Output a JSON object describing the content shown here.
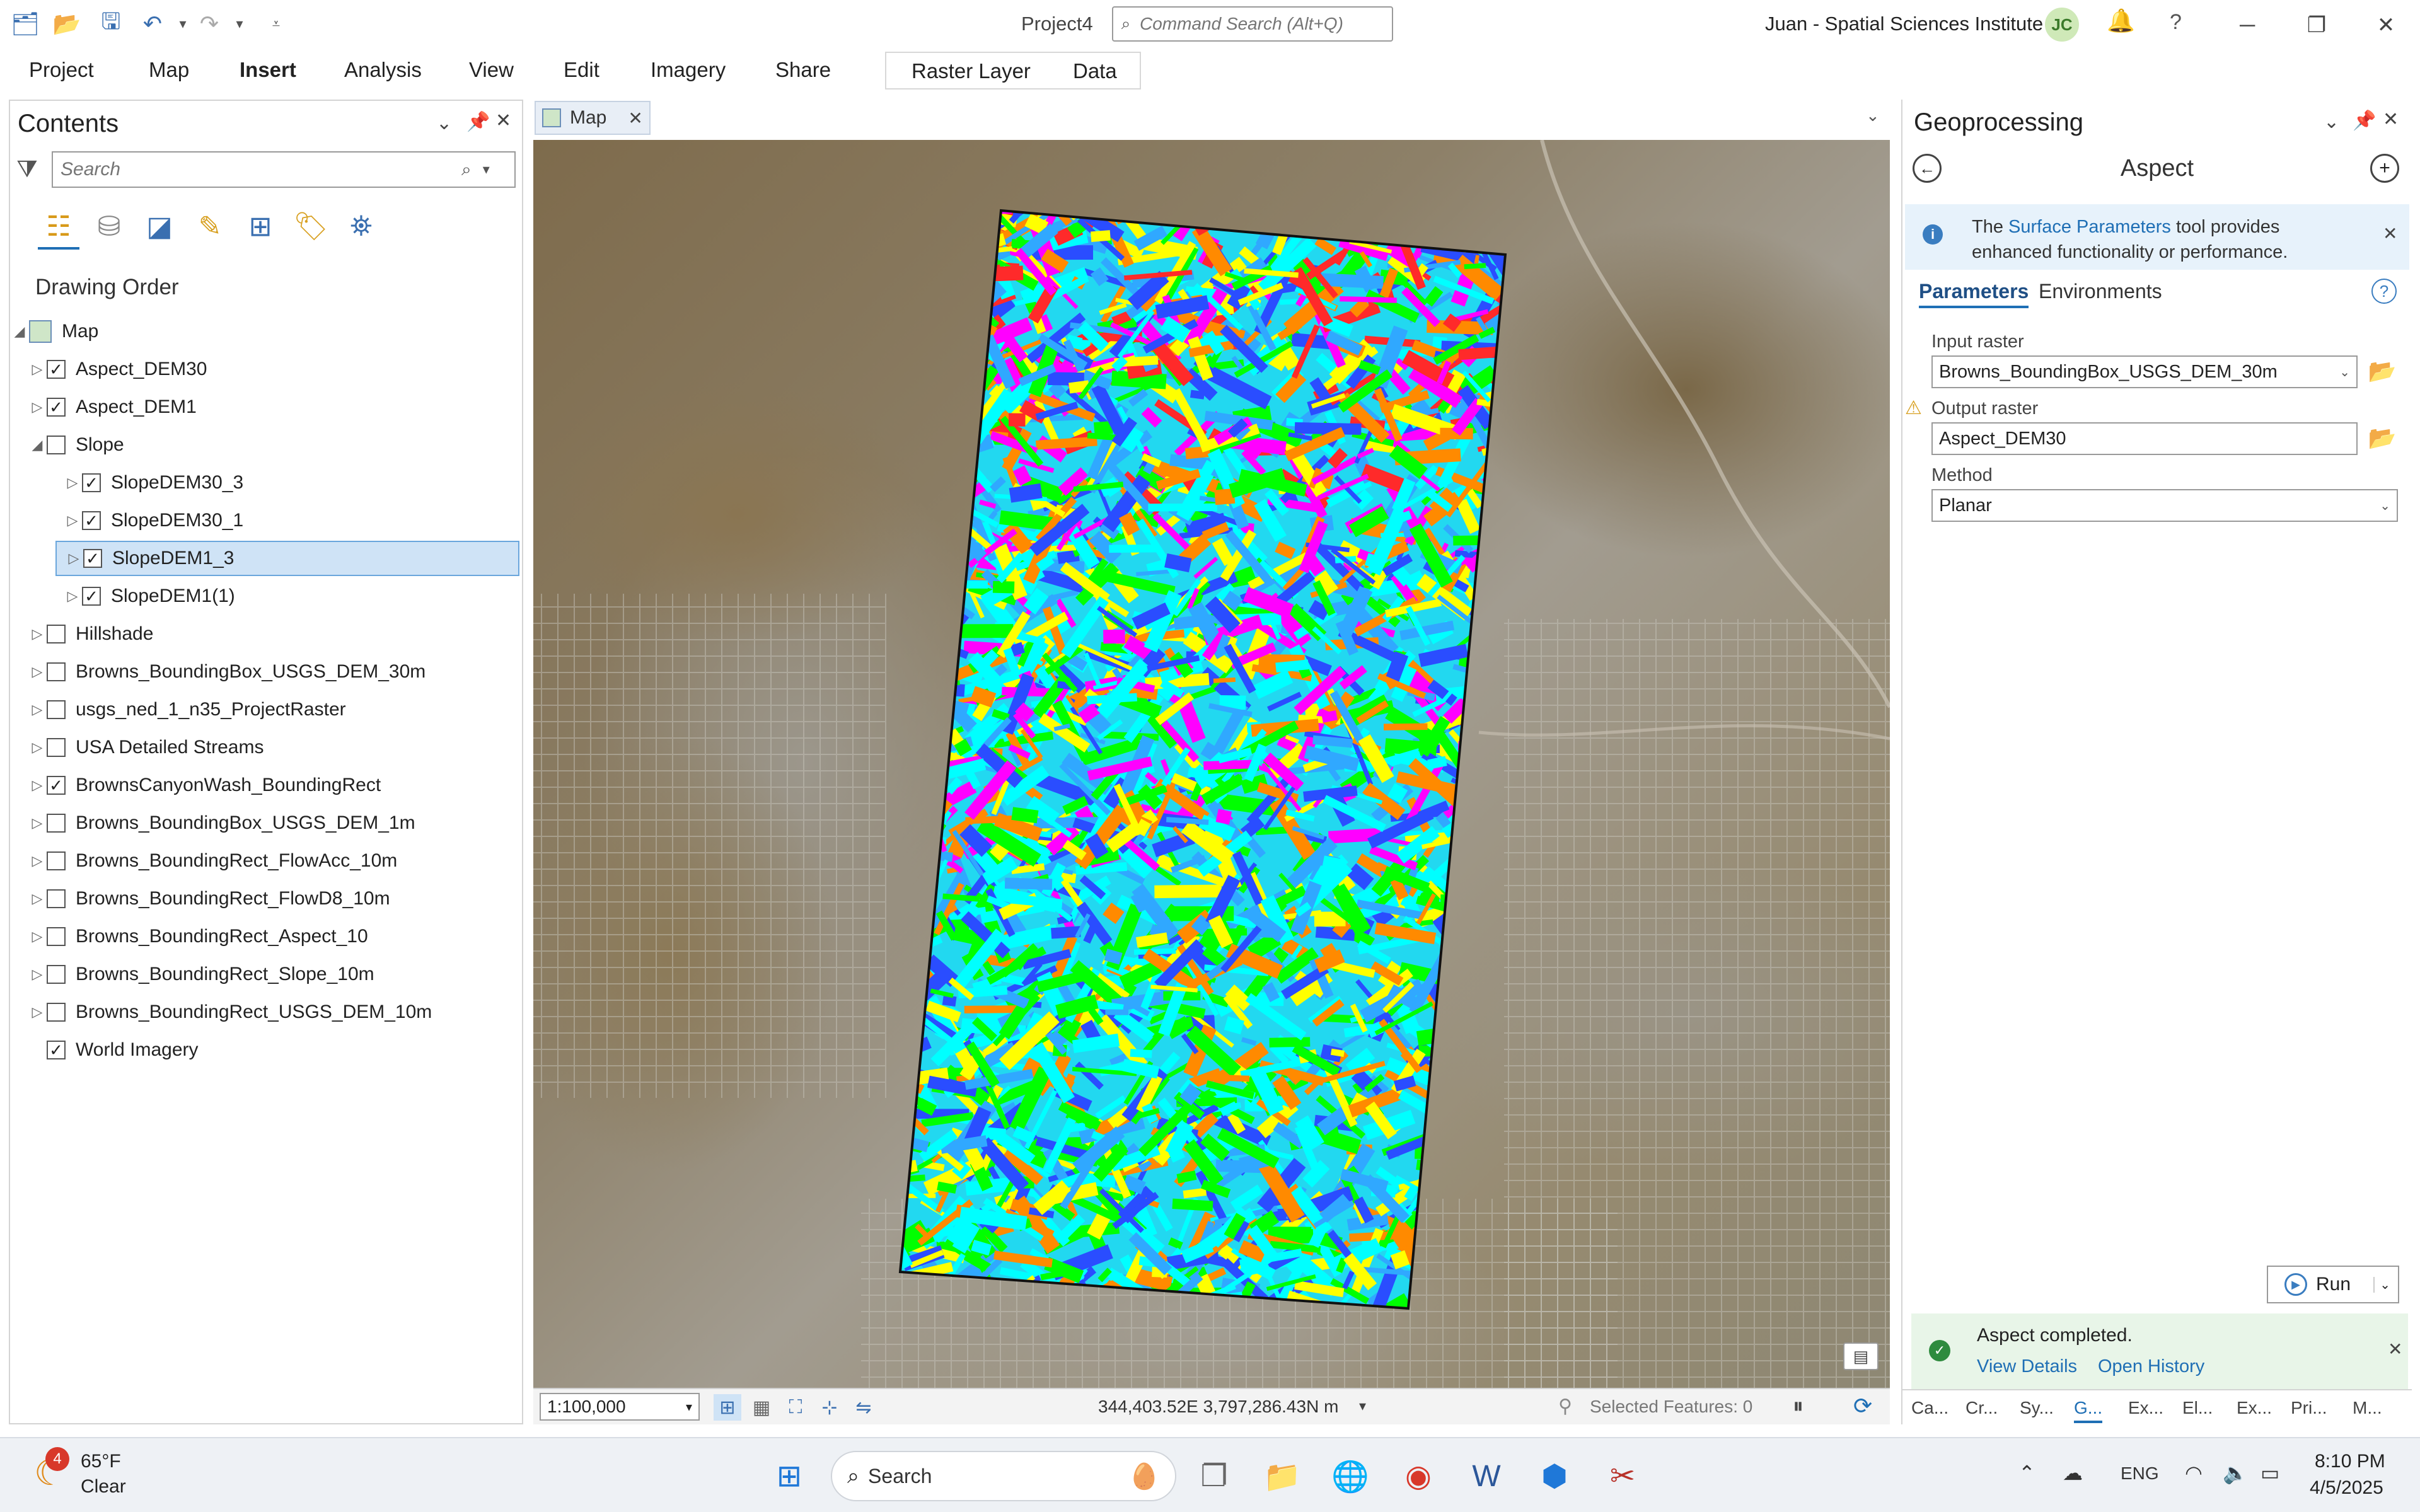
{
  "titlebar": {
    "project_title": "Project4",
    "command_search_placeholder": "Command Search (Alt+Q)",
    "user": "Juan - Spatial Sciences Institute",
    "avatar_initials": "JC",
    "help_symbol": "?"
  },
  "ribbon": {
    "tabs": [
      "Project",
      "Map",
      "Insert",
      "Analysis",
      "View",
      "Edit",
      "Imagery",
      "Share"
    ],
    "active_tab": "Insert",
    "contextual_tabs": [
      "Raster Layer",
      "Data"
    ]
  },
  "contents": {
    "title": "Contents",
    "search_placeholder": "Search",
    "section_title": "Drawing Order",
    "map_label": "Map",
    "layers": [
      {
        "name": "Aspect_DEM30",
        "checked": true,
        "indent": 0,
        "expander": "▷"
      },
      {
        "name": "Aspect_DEM1",
        "checked": true,
        "indent": 0,
        "expander": "▷"
      },
      {
        "name": "Slope",
        "checked": false,
        "indent": 0,
        "expander": "◢"
      },
      {
        "name": "SlopeDEM30_3",
        "checked": true,
        "indent": 1,
        "expander": "▷"
      },
      {
        "name": "SlopeDEM30_1",
        "checked": true,
        "indent": 1,
        "expander": "▷"
      },
      {
        "name": "SlopeDEM1_3",
        "checked": true,
        "indent": 1,
        "expander": "▷",
        "selected": true
      },
      {
        "name": "SlopeDEM1(1)",
        "checked": true,
        "indent": 1,
        "expander": "▷"
      },
      {
        "name": "Hillshade",
        "checked": false,
        "indent": 0,
        "expander": "▷"
      },
      {
        "name": "Browns_BoundingBox_USGS_DEM_30m",
        "checked": false,
        "indent": 0,
        "expander": "▷"
      },
      {
        "name": "usgs_ned_1_n35_ProjectRaster",
        "checked": false,
        "indent": 0,
        "expander": "▷"
      },
      {
        "name": "USA Detailed Streams",
        "checked": false,
        "indent": 0,
        "expander": "▷"
      },
      {
        "name": "BrownsCanyonWash_BoundingRect",
        "checked": true,
        "indent": 0,
        "expander": "▷"
      },
      {
        "name": "Browns_BoundingBox_USGS_DEM_1m",
        "checked": false,
        "indent": 0,
        "expander": "▷"
      },
      {
        "name": "Browns_BoundingRect_FlowAcc_10m",
        "checked": false,
        "indent": 0,
        "expander": "▷"
      },
      {
        "name": "Browns_BoundingRect_FlowD8_10m",
        "checked": false,
        "indent": 0,
        "expander": "▷"
      },
      {
        "name": "Browns_BoundingRect_Aspect_10",
        "checked": false,
        "indent": 0,
        "expander": "▷"
      },
      {
        "name": "Browns_BoundingRect_Slope_10m",
        "checked": false,
        "indent": 0,
        "expander": "▷"
      },
      {
        "name": "Browns_BoundingRect_USGS_DEM_10m",
        "checked": false,
        "indent": 0,
        "expander": "▷"
      },
      {
        "name": "World Imagery",
        "checked": true,
        "indent": 0,
        "expander": ""
      }
    ]
  },
  "map": {
    "tab_label": "Map",
    "scale": "1:100,000",
    "coordinates": "344,403.52E 3,797,286.43N m",
    "selected_features": "Selected Features: 0",
    "aspect_palette": [
      "#ff2a2a",
      "#ff8a00",
      "#ffff00",
      "#00ff00",
      "#00ffff",
      "#30a8ff",
      "#2a4dff",
      "#ff00ff"
    ]
  },
  "geoprocessing": {
    "title": "Geoprocessing",
    "tool_name": "Aspect",
    "info_prefix": "The ",
    "info_link": "Surface Parameters",
    "info_suffix": " tool provides enhanced functionality or performance.",
    "tabs": [
      "Parameters",
      "Environments"
    ],
    "input_raster_label": "Input raster",
    "input_raster_value": "Browns_BoundingBox_USGS_DEM_30m",
    "output_raster_label": "Output raster",
    "output_raster_value": "Aspect_DEM30",
    "method_label": "Method",
    "method_value": "Planar",
    "run_label": "Run",
    "message": "Aspect completed.",
    "view_details": "View Details",
    "open_history": "Open History",
    "bottom_tabs": [
      "Ca...",
      "Cr...",
      "Sy...",
      "G...",
      "Ex...",
      "El...",
      "Ex...",
      "Pri...",
      "M..."
    ],
    "active_bottom_tab": "G..."
  },
  "taskbar": {
    "weather_temp": "65°F",
    "weather_condition": "Clear",
    "weather_badge": "4",
    "search_label": "Search",
    "language": "ENG",
    "time": "8:10 PM",
    "date": "4/5/2025"
  }
}
